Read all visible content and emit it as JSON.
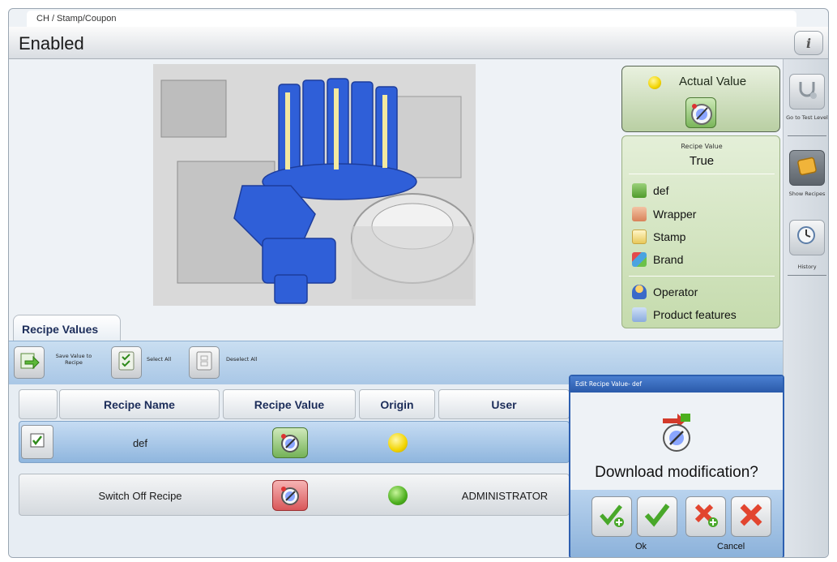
{
  "header": {
    "breadcrumb": "CH / Stamp/Coupon",
    "title": "Enabled",
    "info_icon": "info-icon"
  },
  "sidebar": {
    "items": [
      {
        "label": "Go to Test Level",
        "icon": "stethoscope-icon"
      },
      {
        "label": "Show Recipes",
        "icon": "recipe-book-icon"
      },
      {
        "label": "History",
        "icon": "history-icon"
      }
    ]
  },
  "value_panel": {
    "actual_label": "Actual Value",
    "recipe_value_label": "Recipe Value",
    "recipe_value": "True",
    "recipes": [
      {
        "label": "def",
        "icon": "download-icon"
      },
      {
        "label": "Wrapper",
        "icon": "wrapper-icon"
      },
      {
        "label": "Stamp",
        "icon": "stamp-icon"
      },
      {
        "label": "Brand",
        "icon": "brand-icon"
      }
    ],
    "extra": [
      {
        "label": "Operator",
        "icon": "operator-icon"
      },
      {
        "label": "Product features",
        "icon": "product-features-icon"
      }
    ]
  },
  "tab": {
    "label": "Recipe Values"
  },
  "toolbar": {
    "save_label": "Save Value to Recipe",
    "select_all_label": "Select All",
    "deselect_all_label": "Deselect All"
  },
  "table": {
    "columns": [
      "Recipe Name",
      "Recipe Value",
      "Origin",
      "User"
    ],
    "rows": [
      {
        "name": "def",
        "selected": true,
        "origin_color": "#f2d400",
        "user": ""
      },
      {
        "name": "Switch Off Recipe",
        "selected": false,
        "origin_color": "#4caf1e",
        "user": "ADMINISTRATOR"
      }
    ]
  },
  "dialog": {
    "title": "Edit Recipe Value- def",
    "message": "Download modification?",
    "ok_label": "Ok",
    "cancel_label": "Cancel"
  },
  "colors": {
    "accent": "#2d5fb0",
    "panel_green": "#c5dbad",
    "machine_blue": "#2f5fd8"
  }
}
